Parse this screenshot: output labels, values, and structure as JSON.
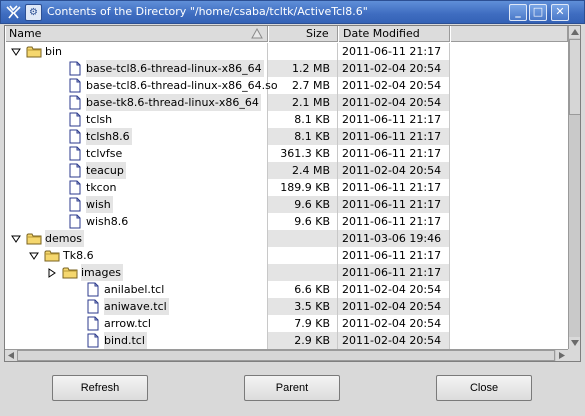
{
  "window": {
    "title": "Contents of the Directory \"/home/csaba/tcltk/ActiveTcl8.6\"",
    "menu_glyph": "⚙",
    "minimize_glyph": "_",
    "maximize_glyph": "□",
    "close_glyph": "✕"
  },
  "columns": {
    "name": "Name",
    "size": "Size",
    "date": "Date Modified"
  },
  "rows": [
    {
      "depth": 0,
      "type": "folder",
      "expander": "open",
      "name": "bin",
      "size": "",
      "date": "2011-06-11 21:17"
    },
    {
      "depth": 1,
      "type": "file",
      "expander": "none",
      "name": "base-tcl8.6-thread-linux-x86_64",
      "size": "1.2 MB",
      "date": "2011-02-04 20:54"
    },
    {
      "depth": 1,
      "type": "file",
      "expander": "none",
      "name": "base-tcl8.6-thread-linux-x86_64.so",
      "size": "2.7 MB",
      "date": "2011-02-04 20:54"
    },
    {
      "depth": 1,
      "type": "file",
      "expander": "none",
      "name": "base-tk8.6-thread-linux-x86_64",
      "size": "2.1 MB",
      "date": "2011-02-04 20:54"
    },
    {
      "depth": 1,
      "type": "file",
      "expander": "none",
      "name": "tclsh",
      "size": "8.1 KB",
      "date": "2011-06-11 21:17"
    },
    {
      "depth": 1,
      "type": "file",
      "expander": "none",
      "name": "tclsh8.6",
      "size": "8.1 KB",
      "date": "2011-06-11 21:17"
    },
    {
      "depth": 1,
      "type": "file",
      "expander": "none",
      "name": "tclvfse",
      "size": "361.3 KB",
      "date": "2011-06-11 21:17"
    },
    {
      "depth": 1,
      "type": "file",
      "expander": "none",
      "name": "teacup",
      "size": "2.4 MB",
      "date": "2011-02-04 20:54"
    },
    {
      "depth": 1,
      "type": "file",
      "expander": "none",
      "name": "tkcon",
      "size": "189.9 KB",
      "date": "2011-06-11 21:17"
    },
    {
      "depth": 1,
      "type": "file",
      "expander": "none",
      "name": "wish",
      "size": "9.6 KB",
      "date": "2011-06-11 21:17"
    },
    {
      "depth": 1,
      "type": "file",
      "expander": "none",
      "name": "wish8.6",
      "size": "9.6 KB",
      "date": "2011-06-11 21:17"
    },
    {
      "depth": 0,
      "type": "folder",
      "expander": "open",
      "name": "demos",
      "size": "",
      "date": "2011-03-06 19:46"
    },
    {
      "depth": 1,
      "type": "folder",
      "expander": "open",
      "name": "Tk8.6",
      "size": "",
      "date": "2011-06-11 21:17"
    },
    {
      "depth": 2,
      "type": "folder",
      "expander": "closed",
      "name": "images",
      "size": "",
      "date": "2011-06-11 21:17"
    },
    {
      "depth": 2,
      "type": "file",
      "expander": "none",
      "name": "anilabel.tcl",
      "size": "6.6 KB",
      "date": "2011-02-04 20:54"
    },
    {
      "depth": 2,
      "type": "file",
      "expander": "none",
      "name": "aniwave.tcl",
      "size": "3.5 KB",
      "date": "2011-02-04 20:54"
    },
    {
      "depth": 2,
      "type": "file",
      "expander": "none",
      "name": "arrow.tcl",
      "size": "7.9 KB",
      "date": "2011-02-04 20:54"
    },
    {
      "depth": 2,
      "type": "file",
      "expander": "none",
      "name": "bind.tcl",
      "size": "2.9 KB",
      "date": "2011-02-04 20:54"
    }
  ],
  "buttons": {
    "refresh": "Refresh",
    "parent": "Parent",
    "close": "Close"
  },
  "colors": {
    "titlebar": "#3e6cc0",
    "folder_fill": "#f5d76e",
    "row_stripe": "#e4e4e4"
  }
}
